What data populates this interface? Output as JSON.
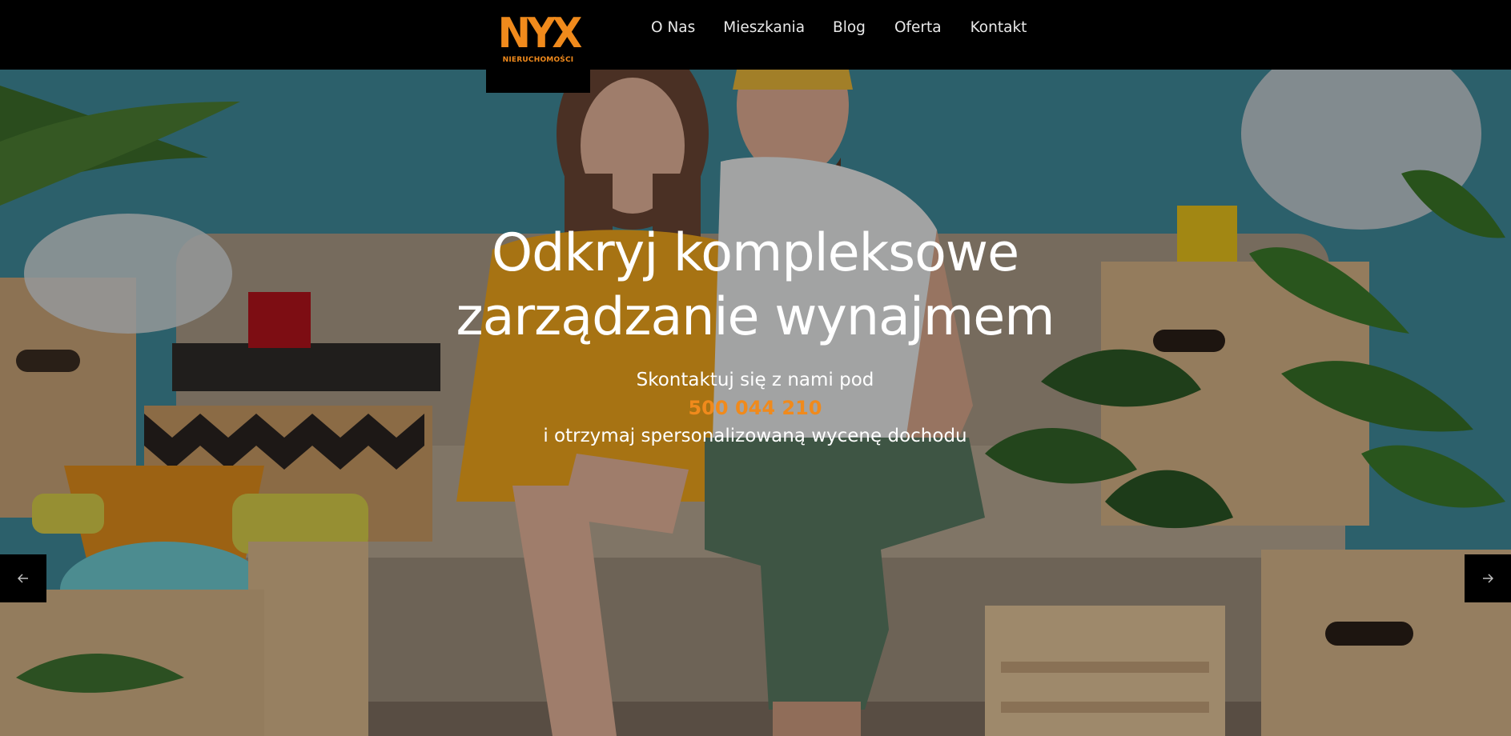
{
  "brand": {
    "logo_mark": "NYX",
    "logo_subtitle": "NIERUCHOMOŚCI",
    "accent_color": "#f08a1c"
  },
  "nav": {
    "items": [
      {
        "label": "O Nas"
      },
      {
        "label": "Mieszkania"
      },
      {
        "label": "Blog"
      },
      {
        "label": "Oferta"
      },
      {
        "label": "Kontakt"
      }
    ]
  },
  "hero": {
    "title_line1": "Odkryj kompleksowe",
    "title_line2": "zarządzanie wynajmem",
    "contact_intro": "Skontaktuj się z nami pod",
    "phone": "500 044 210",
    "contact_outro": "i otrzymaj spersonalizowaną wycenę dochodu",
    "prev_icon": "arrow-left-icon",
    "next_icon": "arrow-right-icon"
  }
}
